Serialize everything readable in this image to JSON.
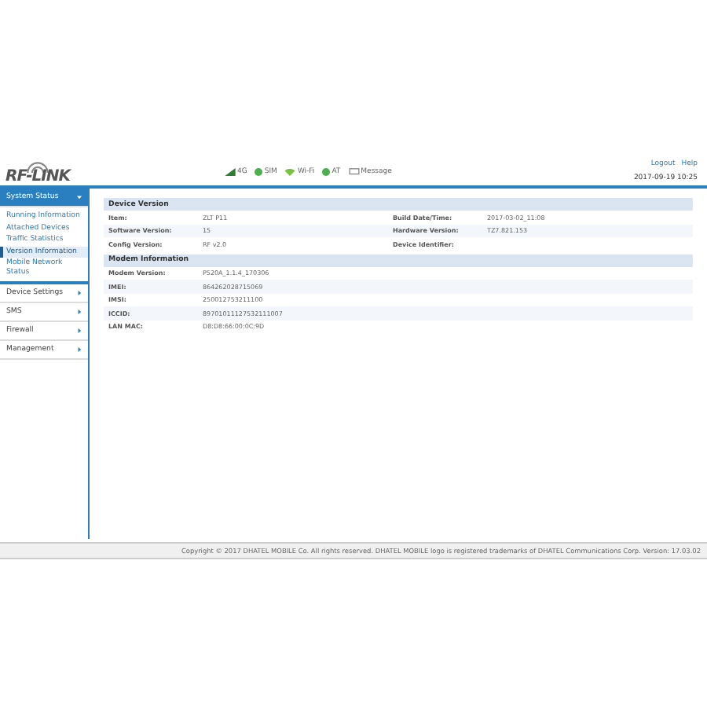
{
  "header": {
    "logo": "RF-LINK",
    "links": [
      "Logout",
      "Help"
    ],
    "datetime": "2017-09-19 10:25"
  },
  "status": [
    {
      "kind": "signal",
      "label": "4G"
    },
    {
      "kind": "dot",
      "label": "SIM"
    },
    {
      "kind": "wifi",
      "label": "Wi-Fi"
    },
    {
      "kind": "dot",
      "label": "AT"
    },
    {
      "kind": "message",
      "label": "Message"
    }
  ],
  "sidebar": {
    "items": [
      {
        "label": "System Status",
        "expanded": true,
        "children": [
          {
            "label": "Running Information",
            "selected": false
          },
          {
            "label": "Attached Devices",
            "selected": false
          },
          {
            "label": "Traffic Statistics",
            "selected": false
          },
          {
            "label": "Version Information",
            "selected": true
          },
          {
            "label": "Mobile Network Status",
            "selected": false
          }
        ]
      },
      {
        "label": "Device Settings",
        "expanded": false
      },
      {
        "label": "SMS",
        "expanded": false
      },
      {
        "label": "Firewall",
        "expanded": false
      },
      {
        "label": "Management",
        "expanded": false
      }
    ]
  },
  "sections": [
    {
      "title": "Device Version",
      "rows": [
        [
          {
            "label": "Item:",
            "value": "ZLT P11"
          },
          {
            "label": "Build Date/Time:",
            "value": "2017-03-02_11:08"
          }
        ],
        [
          {
            "label": "Software Version:",
            "value": "15"
          },
          {
            "label": "Hardware Version:",
            "value": "TZ7.821.153"
          }
        ],
        [
          {
            "label": "Config Version:",
            "value": "RF v2.0"
          },
          {
            "label": "Device Identifier:"
          }
        ]
      ]
    },
    {
      "title": "Modem Information",
      "rows": [
        [
          {
            "label": "Modem Version:",
            "value": "P520A_1.1.4_170306"
          }
        ],
        [
          {
            "label": "IMEI:",
            "value": "864262028715069"
          }
        ],
        [
          {
            "label": "IMSI:",
            "value": "250012753211100"
          }
        ],
        [
          {
            "label": "ICCID:",
            "value": "89701011127532111007"
          }
        ],
        [
          {
            "label": "LAN MAC:",
            "value": "D8:D8:66:00:0C:9D"
          }
        ]
      ]
    }
  ],
  "footer": "Copyright © 2017 DHATEL MOBILE Co. All rights reserved. DHATEL MOBILE logo is registered trademarks of DHATEL Communications Corp. Version: 17.03.02"
}
